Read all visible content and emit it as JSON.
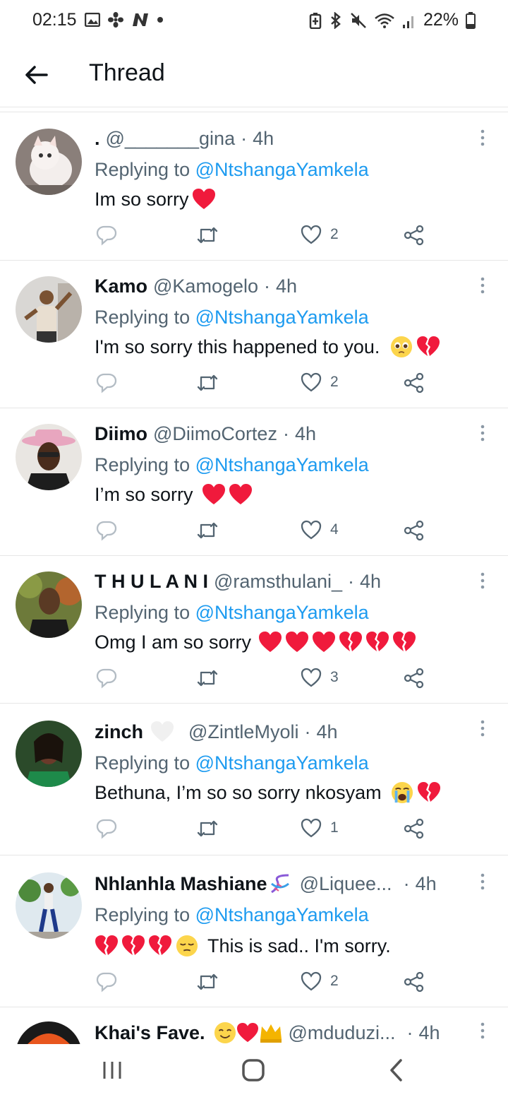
{
  "status_bar": {
    "time": "02:15",
    "battery": "22%",
    "left_icons": [
      "image-icon",
      "fan-icon",
      "n-logo-icon",
      "dot-icon"
    ],
    "right_icons": [
      "battery-saver-icon",
      "bluetooth-icon",
      "mute-icon",
      "wifi-icon",
      "signal-icon",
      "battery-icon"
    ]
  },
  "header": {
    "title": "Thread",
    "back_icon": "arrow-left-icon"
  },
  "colors": {
    "accent": "#1d9bf0",
    "secondary_text": "#536471",
    "heart": "#f01a3c"
  },
  "tweets": [
    {
      "name": ".",
      "handle": "@_______gina",
      "time": "4h",
      "reply_prefix": "Replying to",
      "reply_to": "@NtshangaYamkela",
      "text": "Im so sorry",
      "emojis": [
        "red-heart"
      ],
      "likes": "2"
    },
    {
      "name": "Kamo",
      "handle": "@Kamogelo",
      "time": "4h",
      "reply_prefix": "Replying to",
      "reply_to": "@NtshangaYamkela",
      "text": "I'm so sorry this happened to you.",
      "emojis": [
        "pleading-face",
        "broken-heart"
      ],
      "likes": "2"
    },
    {
      "name": "Diimo",
      "handle": "@DiimoCortez",
      "time": "4h",
      "reply_prefix": "Replying to",
      "reply_to": "@NtshangaYamkela",
      "text": "I’m so sorry",
      "emojis": [
        "red-heart",
        "red-heart"
      ],
      "likes": "4"
    },
    {
      "name": "T H U L A N I",
      "handle": "@ramsthulani_",
      "time": "4h",
      "reply_prefix": "Replying to",
      "reply_to": "@NtshangaYamkela",
      "text": "Omg I am so sorry",
      "emojis": [
        "red-heart",
        "red-heart",
        "red-heart",
        "broken-heart",
        "broken-heart",
        "broken-heart"
      ],
      "likes": "3"
    },
    {
      "name": "zinch",
      "handle": "@ZintleMyoli",
      "time": "4h",
      "reply_prefix": "Replying to",
      "reply_to": "@NtshangaYamkela",
      "text": "Bethuna, I’m so so sorry nkosyam",
      "emojis": [
        "crying-face",
        "broken-heart"
      ],
      "likes": "1"
    },
    {
      "name": "Nhlanhla Mashiane",
      "handle": "@Liquee...",
      "time": "4h",
      "reply_prefix": "Replying to",
      "reply_to": "@NtshangaYamkela",
      "text": "This is sad.. I'm sorry.",
      "emojis": [
        "broken-heart",
        "broken-heart",
        "broken-heart",
        "relieved-face"
      ],
      "likes": "2"
    },
    {
      "name": "Khai's Fave.",
      "handle": "@mduduzi...",
      "time": "4h"
    }
  ],
  "nav_bar": {
    "recents_icon": "recents-icon",
    "home_icon": "home-icon",
    "back_icon": "back-icon"
  }
}
